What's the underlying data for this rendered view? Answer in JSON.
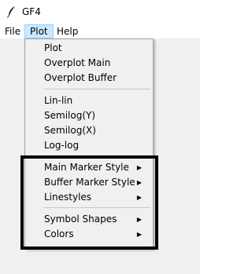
{
  "window": {
    "title": "GF4",
    "icon": "feather-icon"
  },
  "menubar": {
    "items": [
      {
        "label": "File"
      },
      {
        "label": "Plot"
      },
      {
        "label": "Help"
      }
    ]
  },
  "plot_menu": {
    "items": [
      {
        "label": "Plot"
      },
      {
        "label": "Overplot Main"
      },
      {
        "label": "Overplot Buffer"
      },
      {
        "label": "Lin-lin"
      },
      {
        "label": "Semilog(Y)"
      },
      {
        "label": "Semilog(X)"
      },
      {
        "label": "Log-log"
      },
      {
        "label": "Main Marker Style",
        "arrow": "▶"
      },
      {
        "label": "Buffer Marker Style",
        "arrow": "▶"
      },
      {
        "label": "Linestyles",
        "arrow": "▶"
      },
      {
        "label": "Symbol Shapes",
        "arrow": "▶"
      },
      {
        "label": "Colors",
        "arrow": "▶"
      }
    ]
  },
  "colors": {
    "menu_bg": "#f0f0f0",
    "active_bg": "#cce8ff",
    "active_border": "#99d1ff",
    "annotation_border": "#000000"
  }
}
